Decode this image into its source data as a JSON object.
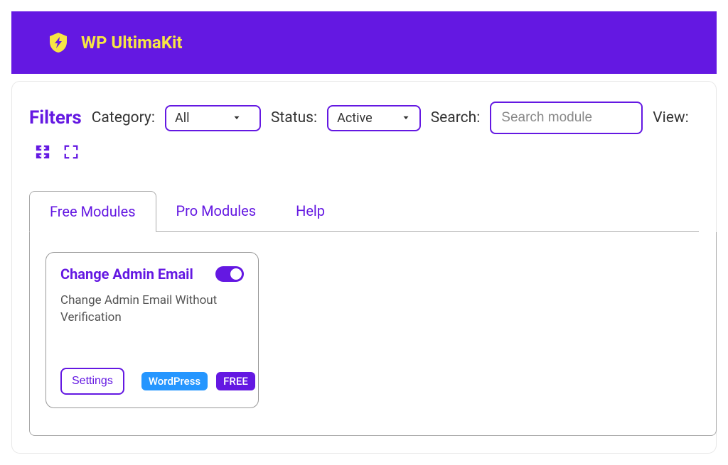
{
  "brand": {
    "name": "WP UltimaKit"
  },
  "filters": {
    "title": "Filters",
    "category_label": "Category:",
    "category_value": "All",
    "status_label": "Status:",
    "status_value": "Active",
    "search_label": "Search:",
    "search_placeholder": "Search module",
    "view_label": "View:"
  },
  "tabs": [
    {
      "label": "Free Modules",
      "active": true
    },
    {
      "label": "Pro Modules",
      "active": false
    },
    {
      "label": "Help",
      "active": false
    }
  ],
  "modules": [
    {
      "title": "Change Admin Email",
      "description": "Change Admin Email Without Verification",
      "enabled": true,
      "settings_label": "Settings",
      "badges": [
        {
          "label": "WordPress",
          "type": "wordpress"
        },
        {
          "label": "FREE",
          "type": "free"
        }
      ]
    }
  ]
}
